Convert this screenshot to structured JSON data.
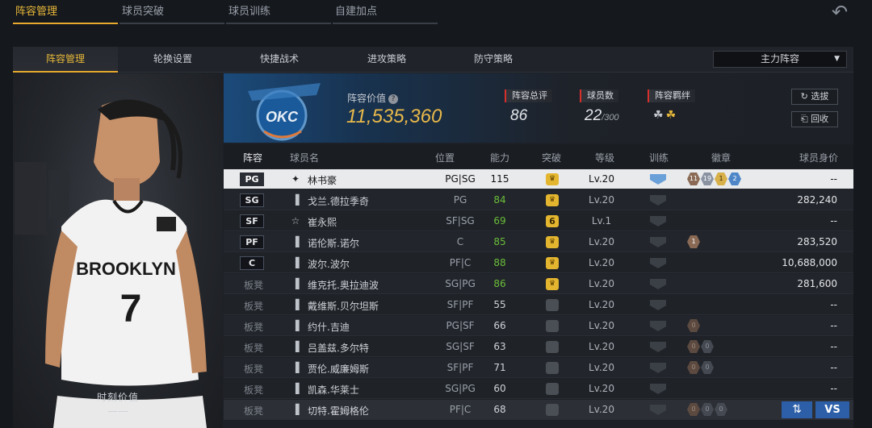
{
  "top_tabs": [
    "阵容管理",
    "球员突破",
    "球员训练",
    "自建加点"
  ],
  "sub_tabs": [
    "阵容管理",
    "轮换设置",
    "快捷战术",
    "进攻策略",
    "防守策略"
  ],
  "lineup_select": "主力阵容",
  "summary": {
    "value_label": "阵容价值",
    "value": "11,535,360",
    "rating_label": "阵容总评",
    "rating": "86",
    "players_label": "球员数",
    "players": "22",
    "players_max": "/300",
    "bond_label": "阵容羁绊",
    "pick_button": "选拔",
    "recycle_button": "回收"
  },
  "portrait": {
    "jersey_name": "BROOKLYN",
    "jersey_number": "7",
    "timed_value_label": "时刻价值",
    "timed_value": "——"
  },
  "team_logo_text": "OKC",
  "table": {
    "headers": [
      "阵容",
      "球员名",
      "位置",
      "能力",
      "突破",
      "等级",
      "训练",
      "徽章",
      "球员身价"
    ],
    "rows": [
      {
        "slot": "PG",
        "name": "林书豪",
        "pos": "PG|SG",
        "rating": "115",
        "break": "crown",
        "level": "Lv.20",
        "price": "--"
      },
      {
        "slot": "SG",
        "name": "戈兰.德拉季奇",
        "pos": "PG",
        "rating": "84",
        "break": "crown",
        "level": "Lv.20",
        "price": "282,240"
      },
      {
        "slot": "SF",
        "name": "崔永熙",
        "pos": "SF|SG",
        "rating": "69",
        "break": "6",
        "level": "Lv.1",
        "price": "--"
      },
      {
        "slot": "PF",
        "name": "诺伦斯.诺尔",
        "pos": "C",
        "rating": "85",
        "break": "crown",
        "level": "Lv.20",
        "price": "283,520"
      },
      {
        "slot": "C",
        "name": "波尔.波尔",
        "pos": "PF|C",
        "rating": "88",
        "break": "crown",
        "level": "Lv.20",
        "price": "10,688,000"
      },
      {
        "slot": "板凳",
        "name": "维克托.奥拉迪波",
        "pos": "SG|PG",
        "rating": "86",
        "break": "crown",
        "level": "Lv.20",
        "price": "281,600"
      },
      {
        "slot": "板凳",
        "name": "戴维斯.贝尔坦斯",
        "pos": "SF|PF",
        "rating": "55",
        "break": "gray",
        "level": "Lv.20",
        "price": "--"
      },
      {
        "slot": "板凳",
        "name": "约什.吉迪",
        "pos": "PG|SF",
        "rating": "66",
        "break": "gray",
        "level": "Lv.20",
        "price": "--"
      },
      {
        "slot": "板凳",
        "name": "吕盖兹.多尔特",
        "pos": "SG|SF",
        "rating": "63",
        "break": "gray",
        "level": "Lv.20",
        "price": "--"
      },
      {
        "slot": "板凳",
        "name": "贾伦.威廉姆斯",
        "pos": "SF|PF",
        "rating": "71",
        "break": "gray",
        "level": "Lv.20",
        "price": "--"
      },
      {
        "slot": "板凳",
        "name": "凯森.华莱士",
        "pos": "SG|PG",
        "rating": "60",
        "break": "gray",
        "level": "Lv.20",
        "price": "--"
      },
      {
        "slot": "板凳",
        "name": "切特.霍姆格伦",
        "pos": "PF|C",
        "rating": "68",
        "break": "gray",
        "level": "Lv.20",
        "price": ""
      }
    ],
    "first_row_badges": [
      "11",
      "19",
      "1",
      "2"
    ],
    "row4_badges": [
      "1"
    ],
    "row8_badges": [
      "0"
    ],
    "row9_badges": [
      "0",
      "0"
    ],
    "row10_badges": [
      "0",
      "0"
    ],
    "row12_badges": [
      "0",
      "0",
      "0"
    ]
  },
  "action_buttons": {
    "swap": "⇅",
    "vs": "VS"
  },
  "colors": {
    "accent": "#e7a92e",
    "value": "#e8b84a",
    "green": "#6bbf3a",
    "button_blue": "#2d5fa8"
  }
}
